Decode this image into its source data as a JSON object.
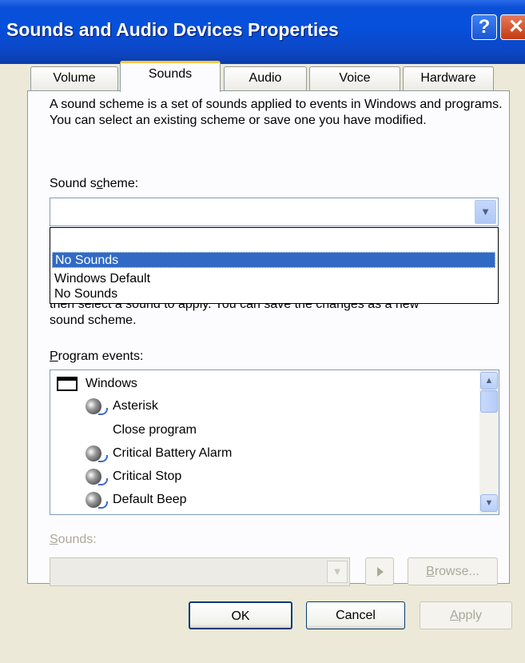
{
  "window": {
    "title": "Sounds and Audio Devices Properties",
    "help_glyph": "?",
    "close_glyph": "✕"
  },
  "tabs": [
    {
      "label": "Volume"
    },
    {
      "label": "Sounds",
      "active": true
    },
    {
      "label": "Audio"
    },
    {
      "label": "Voice"
    },
    {
      "label": "Hardware"
    }
  ],
  "sounds_tab": {
    "description": "A sound scheme is a set of sounds applied to events in Windows and programs. You can select an existing scheme or save one you have modified.",
    "scheme_label_pre": "Sound s",
    "scheme_label_key": "c",
    "scheme_label_post": "heme:",
    "scheme_value": "",
    "scheme_options": [
      {
        "label": "No Sounds",
        "selected": true
      },
      {
        "label": "Windows Default",
        "selected": false
      },
      {
        "label": "No Sounds",
        "selected": false
      }
    ],
    "partial_text_line1": "then select a sound to apply. You can save the changes as a new",
    "partial_text_line2": "sound scheme.",
    "events_label_key": "P",
    "events_label_post": "rogram events:",
    "program_events": [
      {
        "label": "Windows",
        "icon": "window-icon",
        "level": 0
      },
      {
        "label": "Asterisk",
        "icon": "speaker-icon",
        "level": 1
      },
      {
        "label": "Close program",
        "icon": "none",
        "level": 1
      },
      {
        "label": "Critical Battery Alarm",
        "icon": "speaker-icon",
        "level": 1
      },
      {
        "label": "Critical Stop",
        "icon": "speaker-icon",
        "level": 1
      },
      {
        "label": "Default Beep",
        "icon": "speaker-icon",
        "level": 1
      }
    ],
    "sounds_label_key": "S",
    "sounds_label_post": "ounds:",
    "sound_value": "",
    "browse_key": "B",
    "browse_post": "rowse..."
  },
  "footer": {
    "ok": "OK",
    "cancel": "Cancel",
    "apply_key": "A",
    "apply_post": "pply"
  }
}
